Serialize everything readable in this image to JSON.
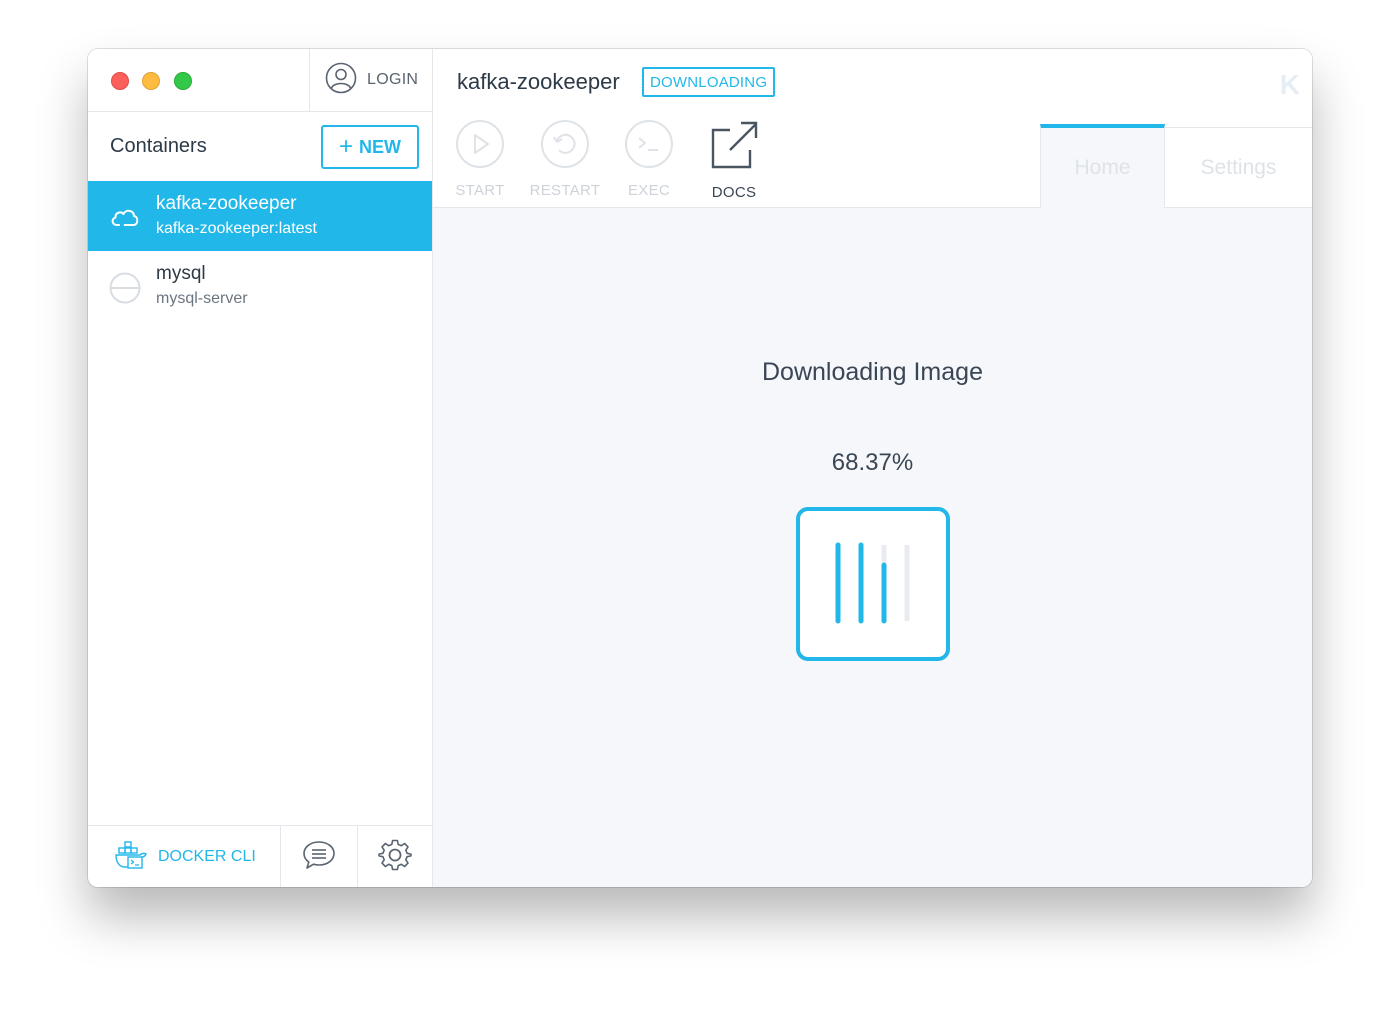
{
  "sidebar": {
    "login_label": "LOGIN",
    "heading": "Containers",
    "new_button": {
      "plus": "+",
      "label": "NEW"
    },
    "containers": [
      {
        "name": "kafka-zookeeper",
        "image": "kafka-zookeeper:latest",
        "state": "downloading",
        "icon": "cloud-icon",
        "selected": true
      },
      {
        "name": "mysql",
        "image": "mysql-server",
        "state": "stopped",
        "icon": "stopped-icon",
        "selected": false
      }
    ],
    "footer": {
      "docker_cli_label": "DOCKER CLI",
      "chat_icon": "chat-icon",
      "settings_icon": "gear-icon"
    }
  },
  "main": {
    "title": "kafka-zookeeper",
    "status_badge": "DOWNLOADING",
    "logo": "K",
    "actions": [
      {
        "label": "START",
        "icon": "play-icon",
        "enabled": false
      },
      {
        "label": "RESTART",
        "icon": "restart-icon",
        "enabled": false
      },
      {
        "label": "EXEC",
        "icon": "terminal-icon",
        "enabled": false
      },
      {
        "label": "DOCS",
        "icon": "external-link-icon",
        "enabled": true
      }
    ],
    "tabs": [
      {
        "label": "Home",
        "active": true
      },
      {
        "label": "Settings",
        "active": false
      }
    ],
    "download": {
      "title": "Downloading Image",
      "percent_text": "68.37%",
      "percent": 68.37
    }
  },
  "colors": {
    "accent": "#22b7e9",
    "text": "#2d3a47",
    "muted": "#cdd3d9",
    "content_bg": "#f6f7fa"
  }
}
